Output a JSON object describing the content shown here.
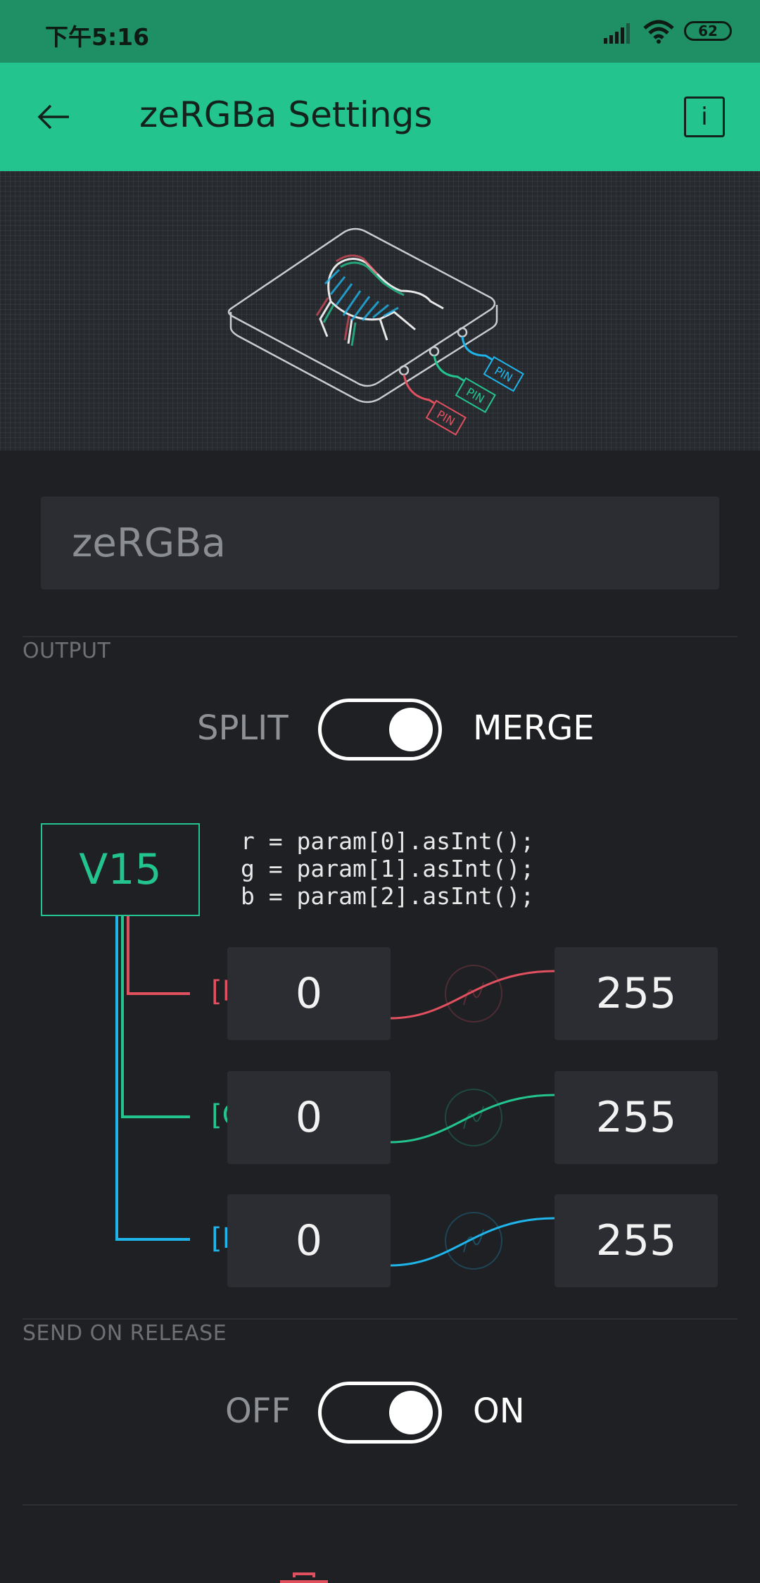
{
  "status_bar": {
    "time": "下午5:16",
    "battery": "62"
  },
  "app_bar": {
    "title": "zeRGBa Settings"
  },
  "widget": {
    "name_placeholder": "zeRGBa"
  },
  "output": {
    "section_label": "OUTPUT",
    "left_label": "SPLIT",
    "right_label": "MERGE",
    "pin": "V15",
    "code": "r = param[0].asInt();\ng = param[1].asInt();\nb = param[2].asInt();",
    "channels": [
      {
        "label": "[R]",
        "min": "0",
        "max": "255",
        "color": "#e0505e"
      },
      {
        "label": "[G]",
        "min": "0",
        "max": "255",
        "color": "#23c48e"
      },
      {
        "label": "[B]",
        "min": "0",
        "max": "255",
        "color": "#1fb5ea"
      }
    ]
  },
  "send_on_release": {
    "section_label": "SEND ON RELEASE",
    "left_label": "OFF",
    "right_label": "ON"
  },
  "hero": {
    "pin_badge": "PIN"
  },
  "colors": {
    "accent": "#23c48e",
    "status_bar": "#1f8f66",
    "background": "#1e2024",
    "red": "#e0505e",
    "green": "#23c48e",
    "blue": "#1fb5ea"
  }
}
